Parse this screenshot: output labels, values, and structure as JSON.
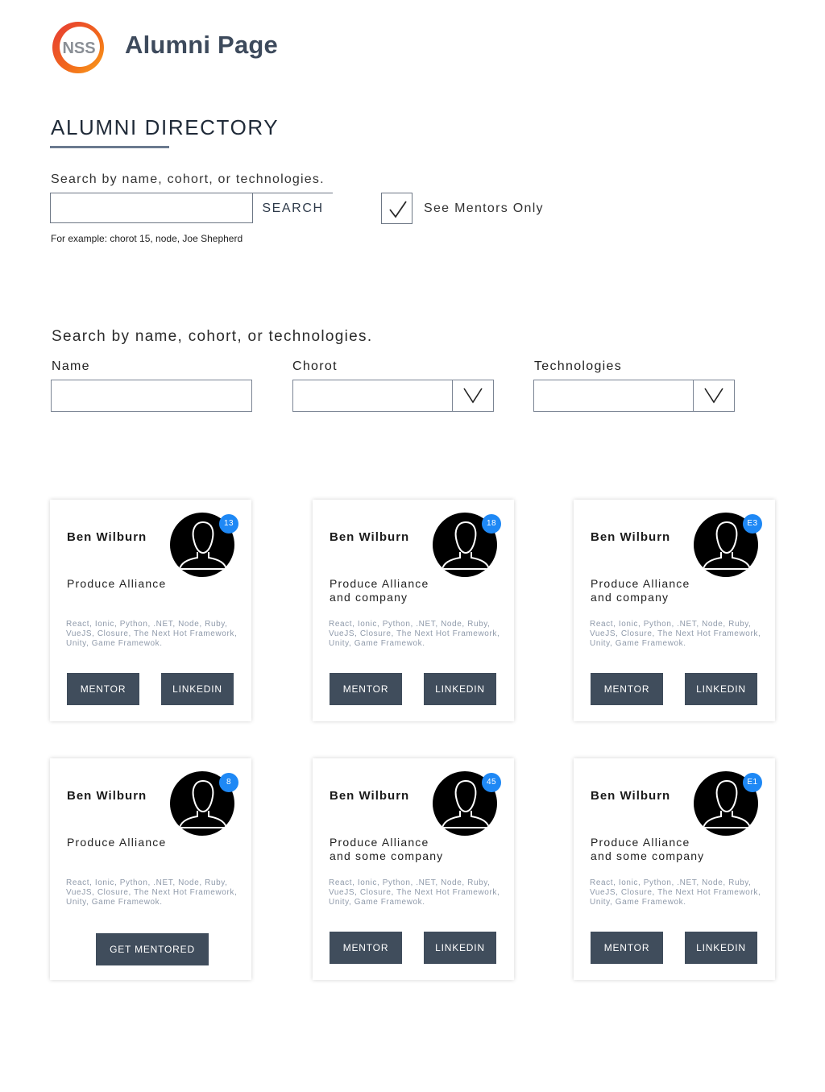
{
  "header": {
    "logo_text": "NSS",
    "app_title": "Alumni Page"
  },
  "directory": {
    "heading": "ALUMNI DIRECTORY",
    "search_label": "Search by name, cohort, or technologies.",
    "search_button": "SEARCH",
    "search_example": "For example: chorot 15, node, Joe Shepherd",
    "mentors_only_label": "See Mentors Only",
    "mentors_only_checked": true
  },
  "filters": {
    "title": "Search by name, cohort, or technologies.",
    "name_label": "Name",
    "cohort_label": "Chorot",
    "technologies_label": "Technologies"
  },
  "colors": {
    "button_bg": "#404d5c",
    "badge_bg": "#1e88f5",
    "title_color": "#3d4a5c"
  },
  "cards": [
    {
      "name": "Ben Wilburn",
      "badge": "13",
      "company": "Produce Alliance",
      "technologies": "React, Ionic, Python, .NET, Node, Ruby, VueJS, Closure, The Next Hot Framework, Unity, Game Framewok.",
      "buttons": [
        "MENTOR",
        "LINKEDIN"
      ]
    },
    {
      "name": "Ben Wilburn",
      "badge": "18",
      "company": "Produce Alliance and company",
      "technologies": "React, Ionic, Python, .NET, Node, Ruby, VueJS, Closure, The Next Hot Framework, Unity, Game Framewok.",
      "buttons": [
        "MENTOR",
        "LINKEDIN"
      ]
    },
    {
      "name": "Ben Wilburn",
      "badge": "E3",
      "company": "Produce Alliance and company",
      "technologies": "React, Ionic, Python, .NET, Node, Ruby, VueJS, Closure, The Next Hot Framework, Unity, Game Framewok.",
      "buttons": [
        "MENTOR",
        "LINKEDIN"
      ]
    },
    {
      "name": "Ben Wilburn",
      "badge": "8",
      "company": "Produce Alliance",
      "technologies": "React, Ionic, Python, .NET, Node, Ruby, VueJS, Closure, The Next Hot Framework, Unity, Game Framewok.",
      "buttons": [
        "GET MENTORED"
      ]
    },
    {
      "name": "Ben Wilburn",
      "badge": "45",
      "company": "Produce Alliance and some company",
      "technologies": "React, Ionic, Python, .NET, Node, Ruby, VueJS, Closure, The Next Hot Framework, Unity, Game Framewok.",
      "buttons": [
        "MENTOR",
        "LINKEDIN"
      ]
    },
    {
      "name": "Ben Wilburn",
      "badge": "E1",
      "company": "Produce Alliance and some company",
      "technologies": "React, Ionic, Python, .NET, Node, Ruby, VueJS, Closure, The Next Hot Framework, Unity, Game Framewok.",
      "buttons": [
        "MENTOR",
        "LINKEDIN"
      ]
    }
  ]
}
